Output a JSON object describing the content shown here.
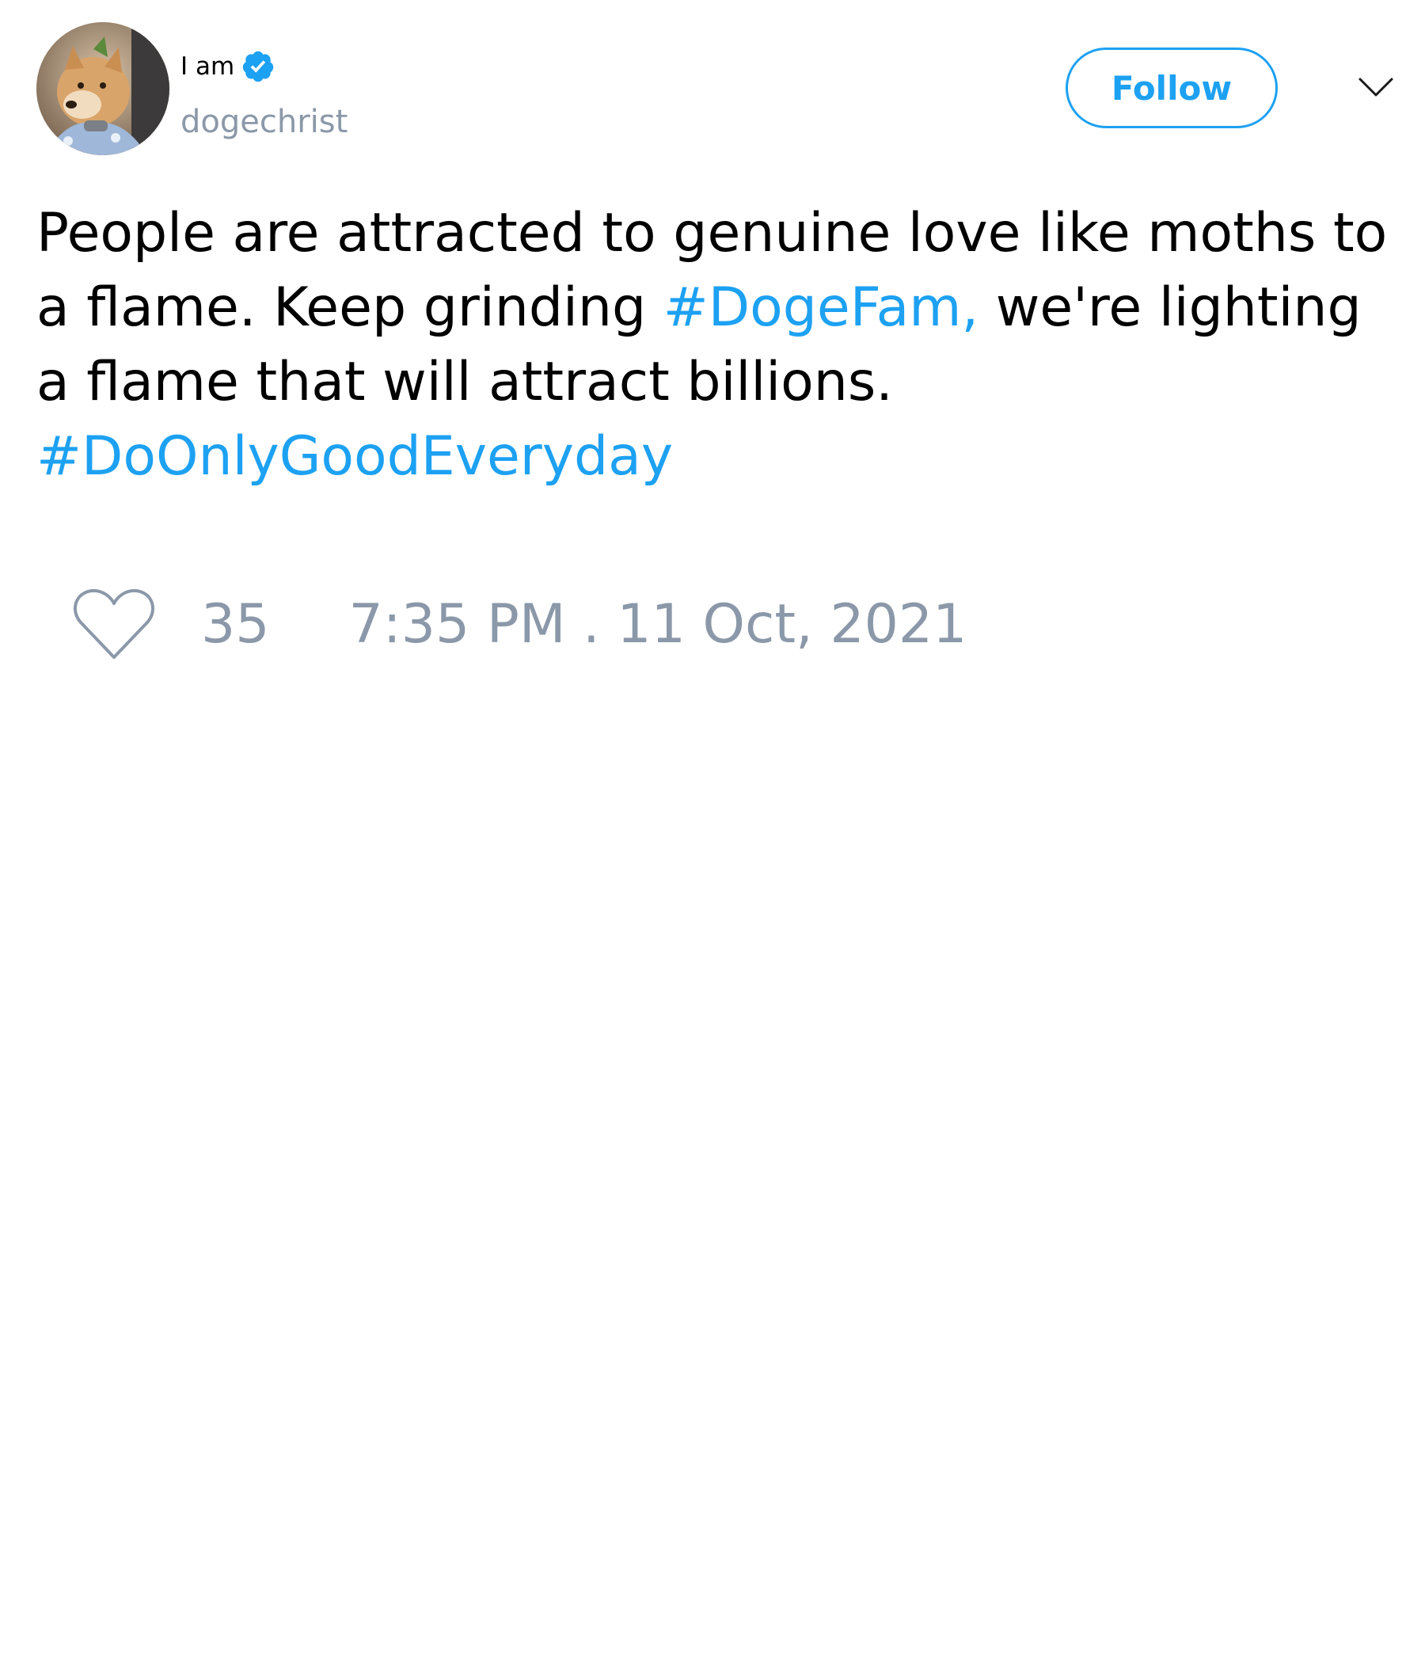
{
  "author": {
    "display_name": "I am",
    "username": "dogechrist",
    "verified": true
  },
  "header": {
    "follow_label": "Follow"
  },
  "tweet": {
    "lines": [
      [
        {
          "text": "People are attracted to genuine love like moths to",
          "type": "text"
        }
      ],
      [
        {
          "text": "a flame. Keep grinding ",
          "type": "text"
        },
        {
          "text": "#DogeFam,",
          "type": "hashtag"
        },
        {
          "text": " we're lighting",
          "type": "text"
        }
      ],
      [
        {
          "text": "a flame that will attract billions.",
          "type": "text"
        }
      ],
      [
        {
          "text": "#DoOnlyGoodEveryday",
          "type": "hashtag"
        }
      ]
    ]
  },
  "footer": {
    "like_count": "35",
    "timestamp": "7:35 PM . 11 Oct, 2021"
  },
  "colors": {
    "accent": "#1da1f2",
    "muted": "#8b98a9",
    "text": "#000000"
  },
  "icons": {
    "verified": "verified-badge-icon",
    "more": "chevron-down-icon",
    "like": "heart-icon"
  }
}
